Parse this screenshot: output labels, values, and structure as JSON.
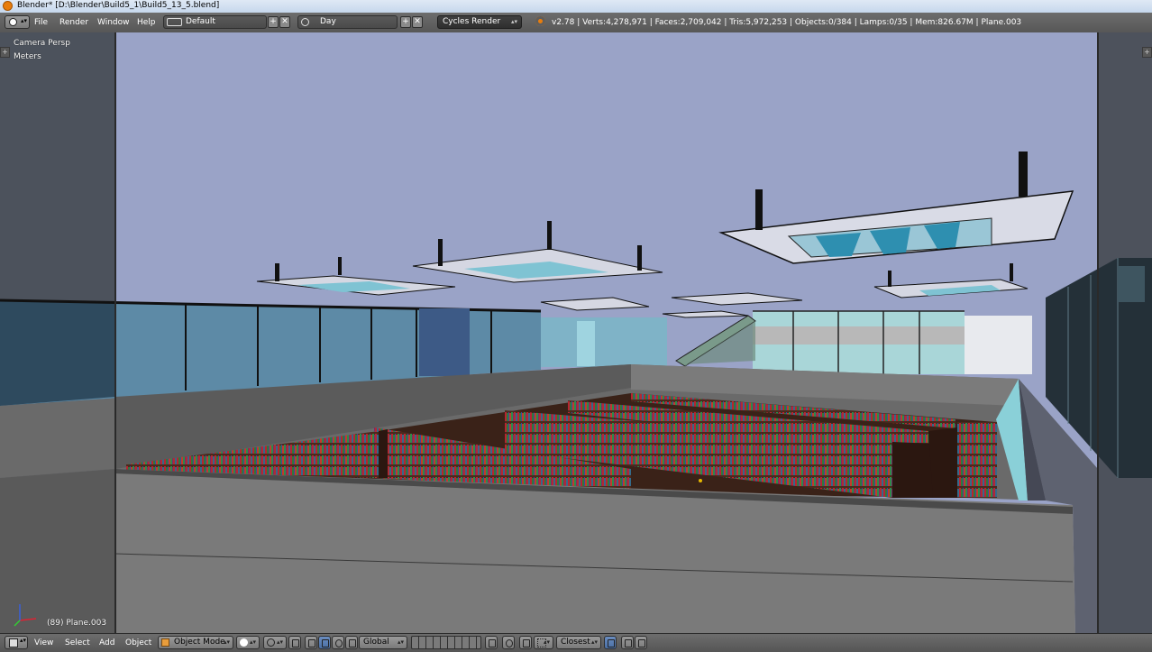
{
  "window": {
    "title": "Blender* [D:\\Blender\\Build5_1\\Build5_13_5.blend]"
  },
  "info_header": {
    "menus": [
      "File",
      "Render",
      "Window",
      "Help"
    ],
    "screen_layout": "Default",
    "scene": "Day",
    "render_engine": "Cycles Render",
    "stats": "v2.78 | Verts:4,278,971 | Faces:2,709,042 | Tris:5,972,253 | Objects:0/384 | Lamps:0/35 | Mem:826.67M | Plane.003"
  },
  "viewport": {
    "view_name": "Camera Persp",
    "units": "Meters",
    "active_object": "(89) Plane.003"
  },
  "view3d_header": {
    "menus": [
      "View",
      "Select",
      "Add",
      "Object"
    ],
    "mode": "Object Mode",
    "transform_orientation": "Global",
    "snap_target": "Closest"
  },
  "icons": {
    "app": "blender-logo-icon",
    "editor_type": "info-editor-icon",
    "layout": "screen-layout-icon",
    "scene": "scene-icon",
    "add": "plus-icon",
    "remove": "x-icon",
    "view3d": "view3d-editor-icon",
    "shading": "solid-sphere-icon",
    "manipulator": "transform-manipulator-icon",
    "snap": "magnet-icon"
  },
  "colors": {
    "header_bg": "#5e5e5e",
    "accent": "#e87d0d",
    "sky": "#9aa3c7"
  }
}
